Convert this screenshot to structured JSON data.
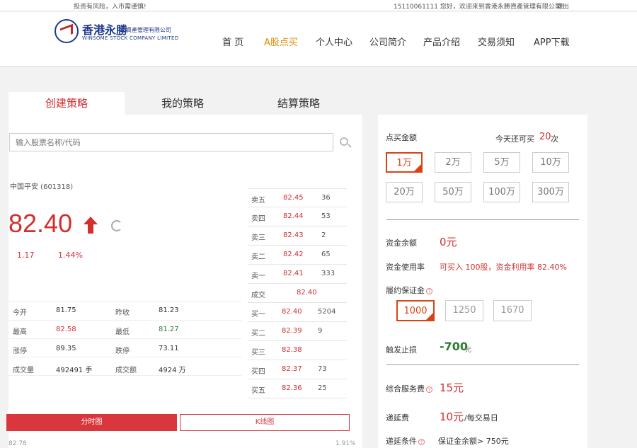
{
  "topbar": {
    "risk_notice": "投资有风险，入市需谨慎!",
    "welcome": "15110061111 您好，欢迎来到香港永勝資產管理有限公司！",
    "logout": "退出"
  },
  "logo": {
    "cn_name": "香港永勝",
    "cn_sub": "資產管理有限公司",
    "en_name": "WINSOME STOCK COMPANY LIMITED"
  },
  "nav": [
    "首 页",
    "A股点买",
    "个人中心",
    "公司简介",
    "产品介绍",
    "交易须知",
    "APP下载"
  ],
  "tabs": [
    "创建策略",
    "我的策略",
    "结算策略"
  ],
  "search": {
    "placeholder": "输入股票名称/代码"
  },
  "stock": {
    "name": "中国平安 (601318)",
    "price": "82.40",
    "change": "1.17",
    "change_pct": "1.44%"
  },
  "stats": [
    {
      "label": "今开",
      "value": "81.75"
    },
    {
      "label": "昨收",
      "value": "81.23"
    },
    {
      "label": "最高",
      "value": "82.58"
    },
    {
      "label": "最低",
      "value": "81.27"
    },
    {
      "label": "涨停",
      "value": "89.35"
    },
    {
      "label": "跌停",
      "value": "73.11"
    },
    {
      "label": "成交量",
      "value": "492491 手"
    },
    {
      "label": "成交额",
      "value": "4924 万"
    }
  ],
  "sell": [
    {
      "label": "卖五",
      "price": "82.45",
      "qty": "36"
    },
    {
      "label": "卖四",
      "price": "82.44",
      "qty": "53"
    },
    {
      "label": "卖三",
      "price": "82.43",
      "qty": "2"
    },
    {
      "label": "卖二",
      "price": "82.42",
      "qty": "65"
    },
    {
      "label": "卖一",
      "price": "82.41",
      "qty": "333"
    }
  ],
  "deal": {
    "label": "成交",
    "price": "82.40"
  },
  "buy": [
    {
      "label": "买一",
      "price": "82.40",
      "qty": "5204"
    },
    {
      "label": "买二",
      "price": "82.39",
      "qty": "9"
    },
    {
      "label": "买三",
      "price": "82.38",
      "qty": ""
    },
    {
      "label": "买四",
      "price": "82.37",
      "qty": "73"
    },
    {
      "label": "买五",
      "price": "82.36",
      "qty": "25"
    }
  ],
  "buttons": {
    "time_chart": "分时图",
    "k_chart": "K线图"
  },
  "chart_cut": {
    "left": "82.78",
    "right": "1.91%"
  },
  "right": {
    "amount_label": "点买金额",
    "remaining_prefix": "今天还可买",
    "remaining_count": "20",
    "remaining_suffix": "次",
    "amounts": [
      "1万",
      "2万",
      "5万",
      "10万",
      "20万",
      "50万",
      "100万",
      "300万"
    ],
    "balance_label": "资金余额",
    "balance_value": "0元",
    "usage_label": "资金使用率",
    "usage_value": "可买入 100股，资金利用率 82.40%",
    "deposit_label": "履约保证金",
    "deposits": [
      "1000",
      "1250",
      "1670"
    ],
    "stoploss_label": "触发止损",
    "stoploss_value": "-700",
    "stoploss_unit": "元",
    "service_label": "综合服务费",
    "service_value": "15元",
    "deferral_label": "递延费",
    "deferral_value": "10元",
    "deferral_unit": "/每交易日",
    "deferral_cond_label": "递延条件",
    "deferral_cond_value": "保证金余额> 750元"
  },
  "colors": {
    "accent": "#d32f2f",
    "brand": "#1e3a8a",
    "nav_active": "#e08a00"
  }
}
